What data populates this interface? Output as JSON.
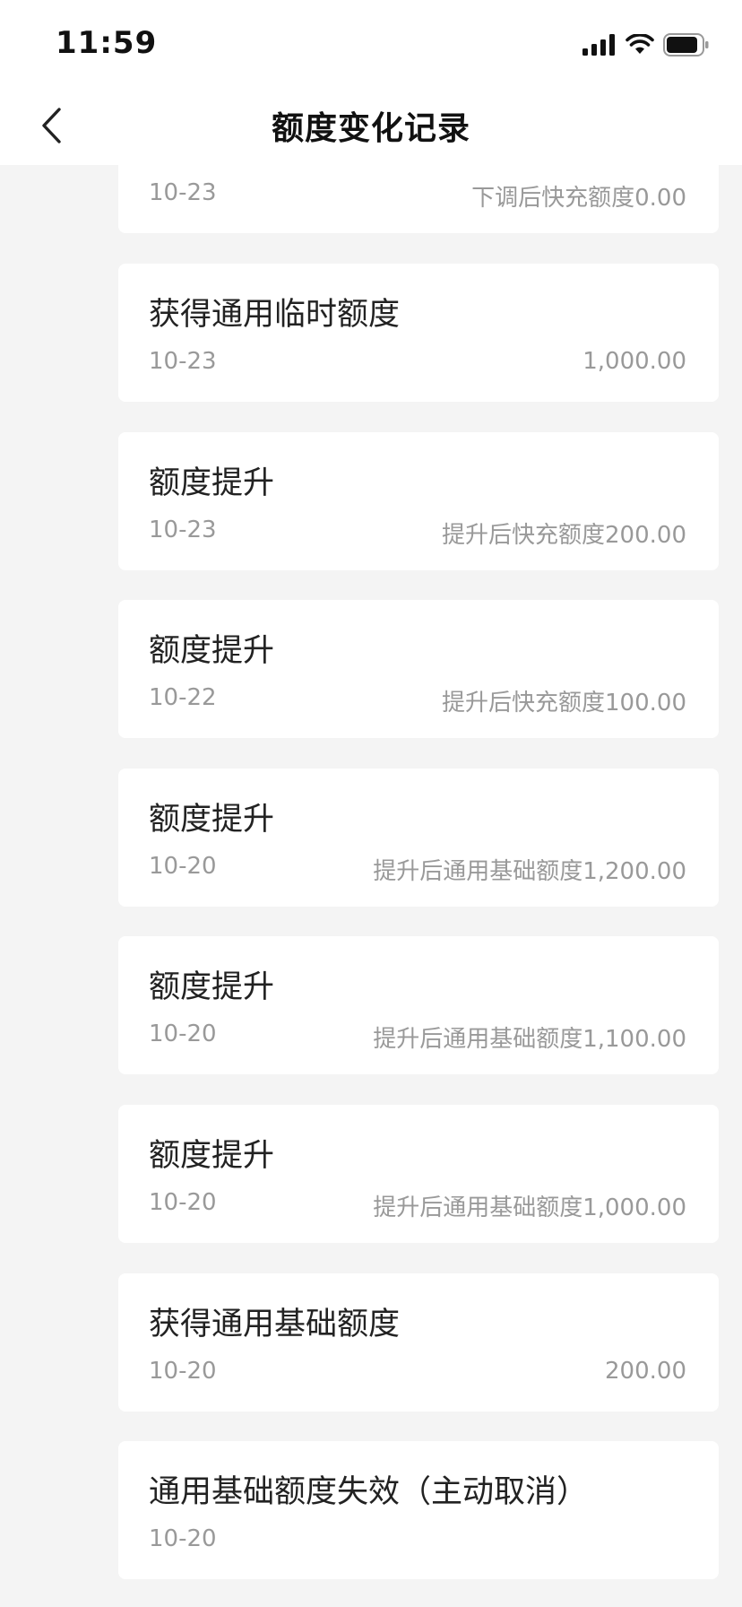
{
  "status_bar": {
    "time": "11:59"
  },
  "header": {
    "title": "额度变化记录",
    "back_icon": "chevron-left-icon"
  },
  "records": [
    {
      "title": "",
      "date": "10-23",
      "amount": "下调后快充额度0.00"
    },
    {
      "title": "获得通用临时额度",
      "date": "10-23",
      "amount": "1,000.00"
    },
    {
      "title": "额度提升",
      "date": "10-23",
      "amount": "提升后快充额度200.00"
    },
    {
      "title": "额度提升",
      "date": "10-22",
      "amount": "提升后快充额度100.00"
    },
    {
      "title": "额度提升",
      "date": "10-20",
      "amount": "提升后通用基础额度1,200.00"
    },
    {
      "title": "额度提升",
      "date": "10-20",
      "amount": "提升后通用基础额度1,100.00"
    },
    {
      "title": "额度提升",
      "date": "10-20",
      "amount": "提升后通用基础额度1,000.00"
    },
    {
      "title": "获得通用基础额度",
      "date": "10-20",
      "amount": "200.00"
    },
    {
      "title": "通用基础额度失效（主动取消）",
      "date": "10-20",
      "amount": ""
    }
  ],
  "colors": {
    "background": "#f4f4f4",
    "card": "#ffffff",
    "title_text": "#222222",
    "secondary_text": "#999999"
  }
}
